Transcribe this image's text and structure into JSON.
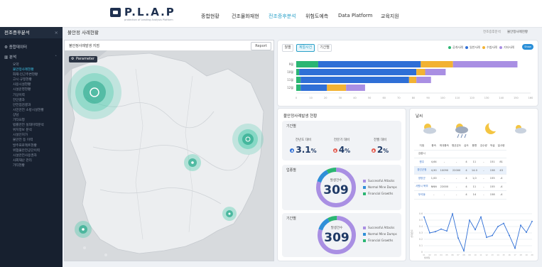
{
  "app": {
    "logo_text": "P.L.A.P",
    "logo_sub": "protection of Leading Analysis Platform"
  },
  "nav": [
    {
      "label": "종합현황",
      "active": false
    },
    {
      "label": "건조물화재현",
      "active": false
    },
    {
      "label": "전조증후분석",
      "active": true
    },
    {
      "label": "위험도예측",
      "active": false
    },
    {
      "label": "Data Platform",
      "active": false
    },
    {
      "label": "교육지원",
      "active": false
    }
  ],
  "sidebar": {
    "title": "전조증후분석",
    "sections": [
      {
        "label": "종합데이터",
        "icon": "gear-icon"
      },
      {
        "label": "분석",
        "icon": "chart-icon"
      }
    ],
    "items": [
      {
        "label": "요약",
        "active": false
      },
      {
        "label": "불안정사례현황",
        "active": true
      },
      {
        "label": "화재·인근주변현황",
        "active": false
      },
      {
        "label": "고시·규정현황",
        "active": false
      },
      {
        "label": "사용시설현황",
        "active": false
      },
      {
        "label": "시설운영현황",
        "active": false
      },
      {
        "label": "기상이력",
        "active": false
      },
      {
        "label": "진단결과",
        "active": false
      },
      {
        "label": "안전점검결과",
        "active": false
      },
      {
        "label": "시민안전 소방시설현황",
        "active": false
      },
      {
        "label": "상담",
        "active": false
      },
      {
        "label": "기타요청",
        "active": false
      },
      {
        "label": "법률안전 실태이력분석",
        "active": false
      },
      {
        "label": "위치정보 분석",
        "active": false
      },
      {
        "label": "시설인허가",
        "active": false
      },
      {
        "label": "불안전 등 이력",
        "active": false
      },
      {
        "label": "발주프로젝트현황",
        "active": false
      },
      {
        "label": "위험물안전공단이력",
        "active": false
      },
      {
        "label": "시설안전사용권자",
        "active": false
      },
      {
        "label": "사회재난 관리",
        "active": false
      },
      {
        "label": "기타현황",
        "active": false
      }
    ]
  },
  "page": {
    "title": "불안정 사례현황",
    "breadcrumb": [
      "전조증후분석",
      "불안정사례현황"
    ]
  },
  "map": {
    "title": "불안정사례발생 지점",
    "report_label": "Report",
    "param_label": "Parameter",
    "hotspots": [
      {
        "region": "서울·경기",
        "intensity": 1.0
      },
      {
        "region": "경북 동해안",
        "intensity": 0.6
      },
      {
        "region": "대전·충청",
        "intensity": 0.35
      },
      {
        "region": "부산·경남",
        "intensity": 0.25
      },
      {
        "region": "전남 해안",
        "intensity": 0.3
      }
    ]
  },
  "stacked": {
    "tabs": [
      {
        "label": "월별",
        "active": false
      },
      {
        "label": "계절사건",
        "active": true
      },
      {
        "label": "기간별",
        "active": false
      }
    ],
    "legend": [
      {
        "label": "공개사례",
        "color": "#2bb673"
      },
      {
        "label": "일반사례",
        "color": "#2f6fd6"
      },
      {
        "label": "수범사례",
        "color": "#f2b233"
      },
      {
        "label": "기타사례",
        "color": "#a98fe3"
      }
    ],
    "toggle_label": "Show",
    "rows": [
      {
        "label": "9월",
        "values": [
          15,
          70,
          22,
          44
        ]
      },
      {
        "label": "10월",
        "values": [
          2,
          80,
          6,
          14
        ]
      },
      {
        "label": "11월",
        "values": [
          3,
          74,
          5,
          10
        ]
      },
      {
        "label": "12월",
        "values": [
          3,
          18,
          13,
          13
        ]
      }
    ],
    "xticks": [
      "0",
      "10",
      "20",
      "30",
      "40",
      "50",
      "60",
      "70",
      "80",
      "90",
      "100",
      "110",
      "120",
      "130",
      "140",
      "150",
      "160"
    ]
  },
  "summary": {
    "title": "불안정사례발생 현황",
    "period": {
      "title": "기간별",
      "metrics": [
        {
          "label": "전년도 대비",
          "value": "3.1",
          "unit": "%",
          "direction": "up",
          "color": "#2f6fd6"
        },
        {
          "label": "전분기 대비",
          "value": "4",
          "unit": "%",
          "direction": "up",
          "color": "#e2574c"
        },
        {
          "label": "전월 대비",
          "value": "2",
          "unit": "%",
          "direction": "up",
          "color": "#e2574c"
        }
      ]
    },
    "donut1": {
      "title": "업종별",
      "center_label": "발생건수",
      "center_value": "309",
      "legend": [
        {
          "label": "Successful Attacks",
          "color": "#a98fe3"
        },
        {
          "label": "Normal Mine Dumps",
          "color": "#2f8fd8"
        },
        {
          "label": "Financial Growths",
          "color": "#2bb673"
        }
      ],
      "values": [
        80,
        12,
        8
      ]
    },
    "donut2": {
      "title": "기간별",
      "center_label": "발생건수",
      "center_value": "309",
      "legend": [
        {
          "label": "Successful Attacks",
          "color": "#a98fe3"
        },
        {
          "label": "Normal Mine Dumps",
          "color": "#2f8fd8"
        },
        {
          "label": "Financial Growths",
          "color": "#2bb673"
        }
      ],
      "values": [
        80,
        12,
        8
      ]
    }
  },
  "weather": {
    "title": "날씨",
    "icons": [
      "partly-cloudy-icon",
      "cloud-rain-icon",
      "moon-icon",
      "partly-cloudy-icon"
    ],
    "columns": [
      "지점",
      "풍속",
      "최대풍속",
      "평균온도",
      "습도",
      "풍향",
      "강수량",
      "적설",
      "일사량"
    ],
    "rows": [
      {
        "cells": [
          "강릉시",
          "",
          "",
          "",
          "",
          "",
          "",
          "",
          ""
        ],
        "selected": false
      },
      {
        "cells": [
          "원주",
          "4,64",
          "-",
          "-",
          "4",
          "11",
          "-",
          "151",
          "81"
        ],
        "selected": false
      },
      {
        "cells": [
          "경선군청",
          "4,90",
          "10090",
          "22000",
          "4",
          "14.0",
          "-",
          "158",
          "43"
        ],
        "selected": true
      },
      {
        "cells": [
          "양양군",
          "1,00",
          "-",
          "-",
          "4",
          "1,0",
          "-",
          "155",
          "-4"
        ],
        "selected": false
      },
      {
        "cells": [
          "서원시 북부",
          "NNN",
          "22000",
          "-",
          "4",
          "11",
          "-",
          "155",
          "-4"
        ],
        "selected": false
      },
      {
        "cells": [
          "부석동",
          "-",
          "-",
          "-",
          "4",
          "14",
          "-",
          "158",
          "-4"
        ],
        "selected": false
      }
    ],
    "line_chart": {
      "ylabel": "상대습도",
      "yticks": [
        "0.6",
        "0.5",
        "0.4",
        "0.3",
        "0.2",
        "0.1",
        "0"
      ],
      "values": [
        0.55,
        0.3,
        0.32,
        0.36,
        0.33,
        0.6,
        0.22,
        0.02,
        0.5,
        0.35,
        0.55,
        0.23,
        0.26,
        0.4,
        0.45,
        0.26,
        0.06,
        0.42,
        0.31,
        0.48
      ],
      "xlabel": "발생일",
      "xticks": [
        "01",
        "02",
        "03",
        "04",
        "05",
        "06",
        "07",
        "08",
        "09",
        "10",
        "11",
        "12",
        "13",
        "14",
        "15",
        "16",
        "17",
        "18",
        "19",
        "20"
      ]
    }
  }
}
